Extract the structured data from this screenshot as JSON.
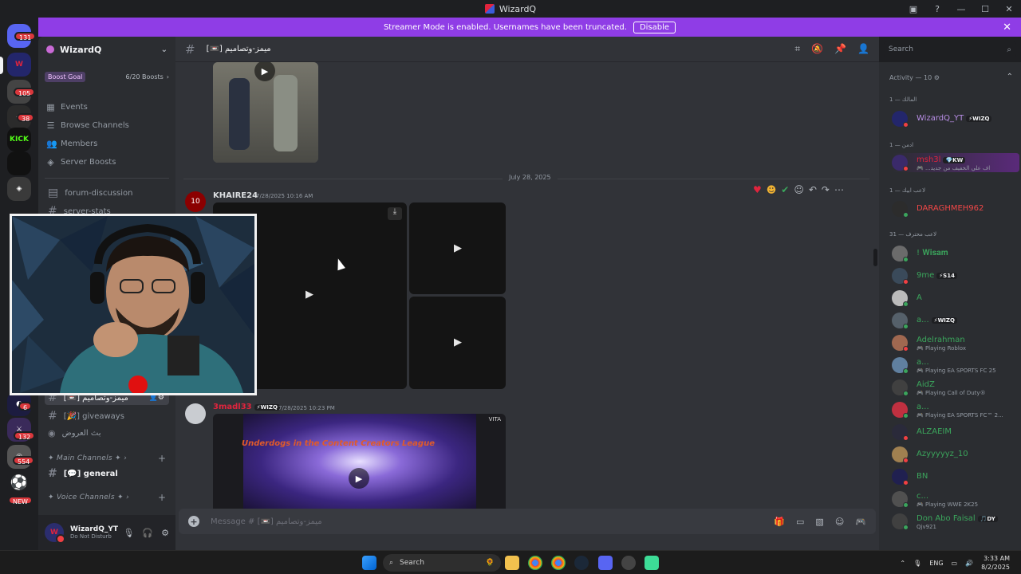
{
  "window": {
    "title": "WizardQ"
  },
  "banner": {
    "text": "Streamer Mode is enabled. Usernames have been truncated.",
    "button": "Disable"
  },
  "rail": {
    "badges": [
      "131",
      "105",
      "38",
      "6",
      "132",
      "554",
      "NEW"
    ],
    "kick_label": "KICK"
  },
  "guild": {
    "name": "WizardQ",
    "boost_label": "Boost Goal",
    "boost_count": "6/20 Boosts",
    "nav": [
      "Events",
      "Browse Channels",
      "Members",
      "Server Boosts"
    ],
    "channels": {
      "forum": "forum-discussion",
      "stats": "server-stats",
      "current": "[📼] ميمز-وتصاميم",
      "giveaways": "[🎉] giveaways",
      "stage": "بث العروض",
      "general": "[💬] general"
    },
    "categories": {
      "main": "✦ Main Channels ✦",
      "voice": "✦ Voice Channels ✦"
    }
  },
  "user": {
    "name": "WizardQ_YT",
    "status": "Do Not Disturb"
  },
  "header": {
    "channel": "[📼] ميمز-وتصاميم",
    "search_placeholder": "Search"
  },
  "chat": {
    "date_divider": "July 28, 2025",
    "messages": [
      {
        "author": "KHAIRE24",
        "time": "7/28/2025 10:16 AM",
        "color": "#e8e8e8"
      },
      {
        "author": "3madl33",
        "tag": "⚡WIZQ",
        "time": "7/28/2025 10:23 PM",
        "color": "#e0243d",
        "video_title": "Underdogs in the Content Creators League",
        "watermark": "VITA"
      }
    ],
    "composer_placeholder": "Message # [📼] ميمز-وتصاميم"
  },
  "members": {
    "activity_label": "Activity — 10",
    "groups": [
      {
        "heading": "المالك — 1",
        "members": [
          {
            "name": "WizardQ_YT",
            "tag": "⚡WIZQ",
            "color": "#b98ee6",
            "activity": ""
          }
        ]
      },
      {
        "heading": "ادمن — 1",
        "members": [
          {
            "name": "msh3l",
            "tag": "💎KW",
            "color": "#e0243d",
            "activity": "🎮 ...اف علي الخفيف من جديد"
          }
        ]
      },
      {
        "heading": "لاعب ابيك — 1",
        "members": [
          {
            "name": "DARAGHMEH962",
            "tag": "",
            "color": "#f04747",
            "activity": ""
          }
        ]
      },
      {
        "heading": "لاعب محترف — 31",
        "members": [
          {
            "name": "! 𝐖𝐢𝐬𝐚𝐦",
            "tag": "",
            "color": "#3ba55c",
            "activity": ""
          },
          {
            "name": "9me",
            "tag": "⚡S14",
            "color": "#3ba55c",
            "activity": ""
          },
          {
            "name": "A",
            "tag": "",
            "color": "#3ba55c",
            "activity": ""
          },
          {
            "name": "a...",
            "tag": "⚡WIZQ",
            "color": "#3ba55c",
            "activity": ""
          },
          {
            "name": "Adelrahman",
            "tag": "",
            "color": "#3ba55c",
            "activity": "🎮 Playing Roblox"
          },
          {
            "name": "a...",
            "tag": "",
            "color": "#3ba55c",
            "activity": "🎮 Playing EA SPORTS FC 25"
          },
          {
            "name": "AidZ",
            "tag": "",
            "color": "#3ba55c",
            "activity": "🎮 Playing Call of Duty®"
          },
          {
            "name": "a...",
            "tag": "",
            "color": "#3ba55c",
            "activity": "🎮 Playing EA SPORTS FC™ 2..."
          },
          {
            "name": "ALZAEIM",
            "tag": "",
            "color": "#3ba55c",
            "activity": ""
          },
          {
            "name": "Azyyyyyz_10",
            "tag": "",
            "color": "#3ba55c",
            "activity": ""
          },
          {
            "name": "BN",
            "tag": "",
            "color": "#3ba55c",
            "activity": ""
          },
          {
            "name": "c...",
            "tag": "",
            "color": "#3ba55c",
            "activity": "🎮 Playing WWE 2K25"
          },
          {
            "name": "Don Abo Faisal",
            "tag": "🎵DY",
            "color": "#3ba55c",
            "activity": "Qjv921"
          }
        ]
      }
    ]
  },
  "taskbar": {
    "search": "Search",
    "lang": "ENG",
    "time": "3:33 AM",
    "date": "8/2/2025"
  }
}
